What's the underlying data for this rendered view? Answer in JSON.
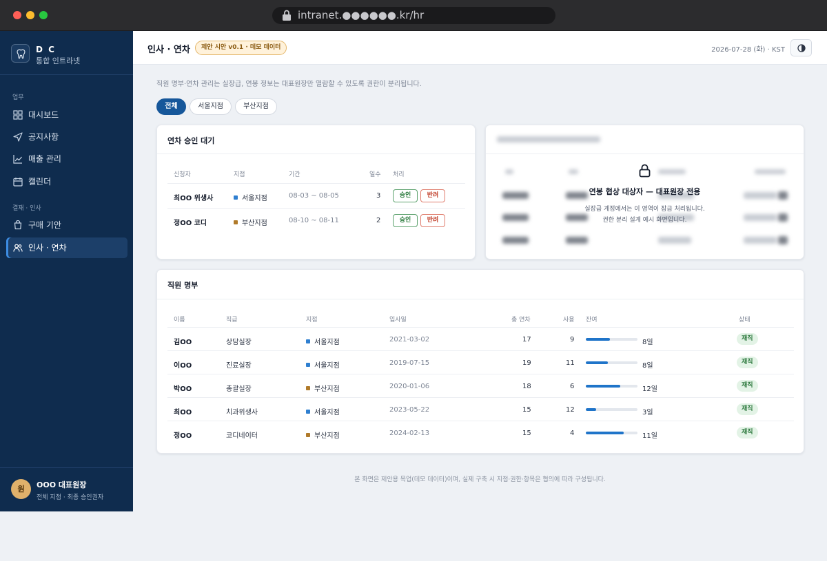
{
  "browser": {
    "url": "intranet.●●●●●●.kr/hr"
  },
  "sidebar": {
    "brand_title": "D C",
    "brand_sub": "통합 인트라넷",
    "sections": [
      {
        "label": "업무",
        "items": [
          {
            "label": "대시보드",
            "icon": "dashboard-icon"
          },
          {
            "label": "공지사항",
            "icon": "send-icon"
          },
          {
            "label": "매출 관리",
            "icon": "chart-icon"
          },
          {
            "label": "캘린더",
            "icon": "calendar-icon"
          }
        ]
      },
      {
        "label": "결재 · 인사",
        "items": [
          {
            "label": "구매 기안",
            "icon": "cart-icon"
          },
          {
            "label": "인사 · 연차",
            "icon": "users-icon",
            "active": true
          }
        ]
      }
    ],
    "user": {
      "avatar_initial": "원",
      "name": "OOO 대표원장",
      "role": "전체 지점 · 최종 승인권자"
    }
  },
  "header": {
    "title": "인사 · 연차",
    "badge": "제안 시안 v0.1 · 데모 데이터",
    "date": "2026-07-28 (화) · KST"
  },
  "intro": "직원 명부·연차 관리는 실장급, 연봉 정보는 대표원장만 열람할 수 있도록 권한이 분리됩니다.",
  "filters": [
    "전체",
    "서울지점",
    "부산지점"
  ],
  "leave_card": {
    "title": "연차 승인 대기",
    "columns": [
      "신청자",
      "지점",
      "기간",
      "일수",
      "처리"
    ],
    "approve_label": "승인",
    "reject_label": "반려",
    "rows": [
      {
        "name": "최OO 위생사",
        "branch": "서울지점",
        "branch_color": "#2f7fd0",
        "period": "08-03 ~ 08-05",
        "days": "3"
      },
      {
        "name": "정OO 코디",
        "branch": "부산지점",
        "branch_color": "#b07a2a",
        "period": "08-10 ~ 08-11",
        "days": "2"
      }
    ]
  },
  "locked_card": {
    "title": "연봉 협상 대상자 — 대표원장 전용",
    "desc_line1": "실장급 계정에서는 이 영역이 잠금 처리됩니다.",
    "desc_line2": "권한 분리 설계 예시 화면입니다."
  },
  "staff_card": {
    "title": "직원 명부",
    "columns": [
      "이름",
      "직급",
      "지점",
      "입사일",
      "총 연차",
      "사용",
      "잔여",
      "상태"
    ],
    "rows": [
      {
        "name": "김OO",
        "position": "상담실장",
        "branch": "서울지점",
        "branch_color": "#2f7fd0",
        "hired": "2021-03-02",
        "total": "17",
        "used": "9",
        "remaining": "8일",
        "remaining_ratio": 0.47,
        "status": "재직"
      },
      {
        "name": "이OO",
        "position": "진료실장",
        "branch": "서울지점",
        "branch_color": "#2f7fd0",
        "hired": "2019-07-15",
        "total": "19",
        "used": "11",
        "remaining": "8일",
        "remaining_ratio": 0.42,
        "status": "재직"
      },
      {
        "name": "박OO",
        "position": "총괄실장",
        "branch": "부산지점",
        "branch_color": "#b07a2a",
        "hired": "2020-01-06",
        "total": "18",
        "used": "6",
        "remaining": "12일",
        "remaining_ratio": 0.67,
        "status": "재직"
      },
      {
        "name": "최OO",
        "position": "치과위생사",
        "branch": "서울지점",
        "branch_color": "#2f7fd0",
        "hired": "2023-05-22",
        "total": "15",
        "used": "12",
        "remaining": "3일",
        "remaining_ratio": 0.2,
        "status": "재직"
      },
      {
        "name": "정OO",
        "position": "코디네이터",
        "branch": "부산지점",
        "branch_color": "#b07a2a",
        "hired": "2024-02-13",
        "total": "15",
        "used": "4",
        "remaining": "11일",
        "remaining_ratio": 0.73,
        "status": "재직"
      }
    ]
  },
  "footer": "본 화면은 제안용 목업(데모 데이터)이며, 실제 구축 시 지점·권한·항목은 협의에 따라 구성됩니다."
}
